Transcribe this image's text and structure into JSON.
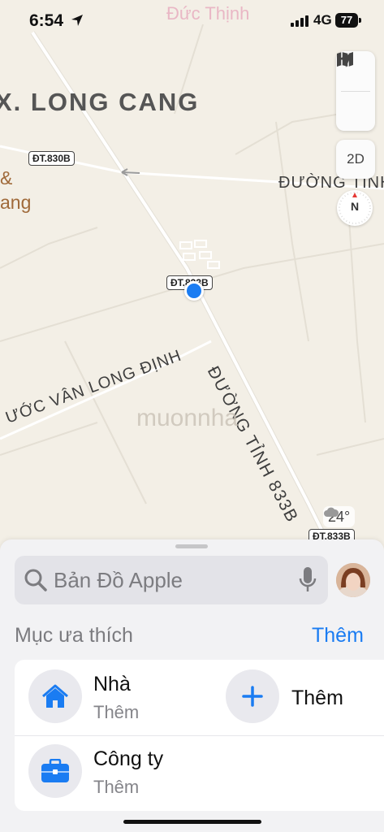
{
  "status": {
    "time": "6:54",
    "network": "4G",
    "battery": "77"
  },
  "map": {
    "top_label": "Đức Thịnh",
    "area_label": "X. LONG CANG",
    "poi_label_line1": "&",
    "poi_label_line2": "ang",
    "road_shields": [
      "ĐT.830B",
      "ĐT.833B",
      "ĐT.833B"
    ],
    "road_labels": [
      "ĐƯỜNG TỈNH",
      "ĐƯỜNG TỈNH 833B",
      "ƯỚC VÂN LONG ĐỊNH"
    ],
    "watermark": "muonnha",
    "controls": {
      "map_icon": "map-icon",
      "locate_icon": "location-arrow-icon",
      "mode": "2D",
      "compass": "N"
    },
    "weather": "24°",
    "colors": {
      "land": "#f3efe6",
      "road": "#ffffff",
      "accent": "#1a7cf2"
    }
  },
  "sheet": {
    "search_placeholder": "Bản Đồ Apple",
    "favorites_title": "Mục ưa thích",
    "favorites_more": "Thêm",
    "favorites": [
      {
        "name": "Nhà",
        "sub": "Thêm",
        "icon": "home-icon"
      },
      {
        "name": "Thêm",
        "sub": "",
        "icon": "plus-icon"
      },
      {
        "name": "Công ty",
        "sub": "Thêm",
        "icon": "briefcase-icon"
      }
    ]
  }
}
